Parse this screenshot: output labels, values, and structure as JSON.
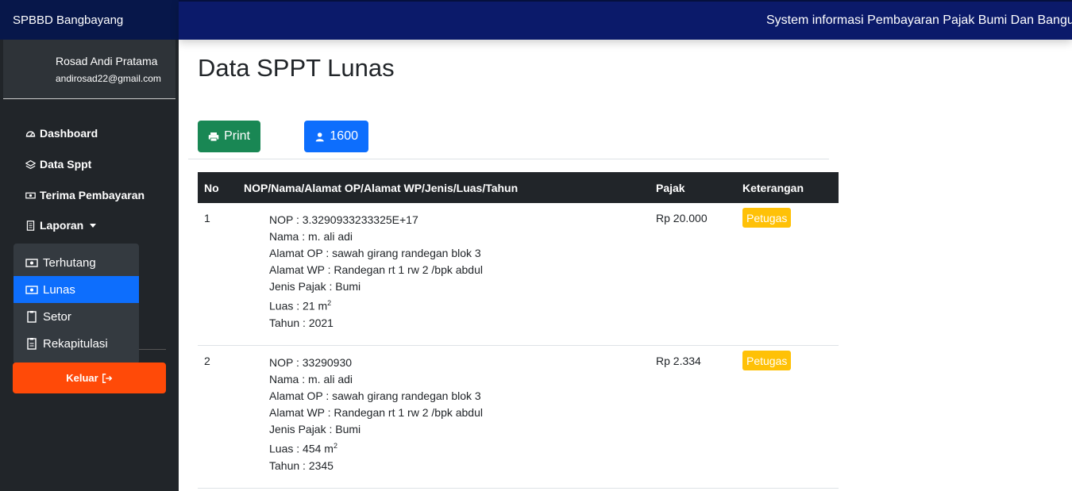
{
  "brand": "SPBBD Bangbayang",
  "marquee": "System informasi Pembayaran Pajak Bumi Dan Bangunan",
  "user": {
    "name": "Rosad Andi Pratama",
    "email": "andirosad22@gmail.com"
  },
  "nav": {
    "dashboard": "Dashboard",
    "data_sppt": "Data Sppt",
    "terima": "Terima Pembayaran",
    "laporan": "Laporan"
  },
  "dropdown": [
    "Terhutang",
    "Lunas",
    "Setor",
    "Rekapitulasi"
  ],
  "logout": "Keluar",
  "page_title": "Data SPPT Lunas",
  "buttons": {
    "print": "Print",
    "count": "1600"
  },
  "table": {
    "headers": [
      "No",
      "NOP/Nama/Alamat OP/Alamat WP/Jenis/Luas/Tahun",
      "Pajak",
      "Keterangan"
    ],
    "rows": [
      {
        "no": "1",
        "nop": "NOP : 3.3290933233325E+17",
        "nama": "Nama : m. ali adi",
        "alamat_op": "Alamat OP : sawah girang randegan blok 3",
        "alamat_wp": "Alamat WP : Randegan rt 1 rw 2 /bpk abdul",
        "jenis": "Jenis Pajak : Bumi",
        "luas": "Luas : 21 m",
        "luas_sup": "2",
        "tahun": "Tahun : 2021",
        "pajak": "Rp 20.000",
        "keterangan": "Petugas"
      },
      {
        "no": "2",
        "nop": "NOP : 33290930",
        "nama": "Nama : m. ali adi",
        "alamat_op": "Alamat OP : sawah girang randegan blok 3",
        "alamat_wp": "Alamat WP : Randegan rt 1 rw 2 /bpk abdul",
        "jenis": "Jenis Pajak : Bumi",
        "luas": "Luas : 454 m",
        "luas_sup": "2",
        "tahun": "Tahun : 2345",
        "pajak": "Rp 2.334",
        "keterangan": "Petugas"
      }
    ]
  },
  "colors": {
    "topbar": "#0b1a6a",
    "sidebar": "#212529",
    "print": "#198754",
    "primary": "#0d6efd",
    "logout": "#ff4a08",
    "badge": "#ffc107"
  }
}
